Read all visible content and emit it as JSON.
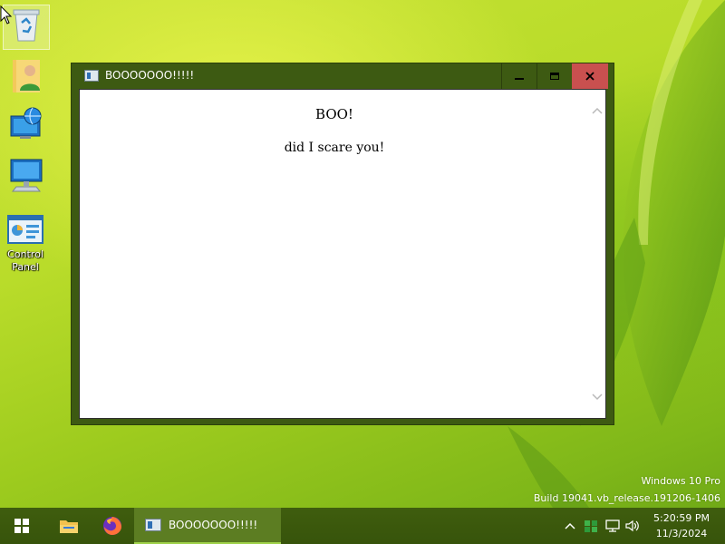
{
  "desktop": {
    "icons": [
      {
        "name": "recycle-bin",
        "label": ""
      },
      {
        "name": "user-folder",
        "label": ""
      },
      {
        "name": "network",
        "label": ""
      },
      {
        "name": "this-pc",
        "label": ""
      },
      {
        "name": "control-panel",
        "label": "Control Panel"
      }
    ],
    "watermark": {
      "line1": "Windows 10 Pro",
      "line2": "Build 19041.vb_release.191206-1406"
    }
  },
  "window": {
    "title": "BOOOOOOO!!!!!",
    "heading": "BOO!",
    "message": "did I scare you!",
    "controls": [
      "minimize-icon",
      "maximize-icon",
      "close-icon"
    ]
  },
  "taskbar": {
    "task_label": "BOOOOOOO!!!!!",
    "clock_time": "5:20:59 PM",
    "clock_date": "11/3/2024",
    "tray_icons": [
      "chevron-up-icon",
      "shield-icon",
      "network-icon",
      "volume-icon"
    ]
  },
  "colors": {
    "titlebar": "#3d5a12",
    "close_button": "#c9504f",
    "taskbar": "#3a570c",
    "active_task": "#5c7d22"
  }
}
